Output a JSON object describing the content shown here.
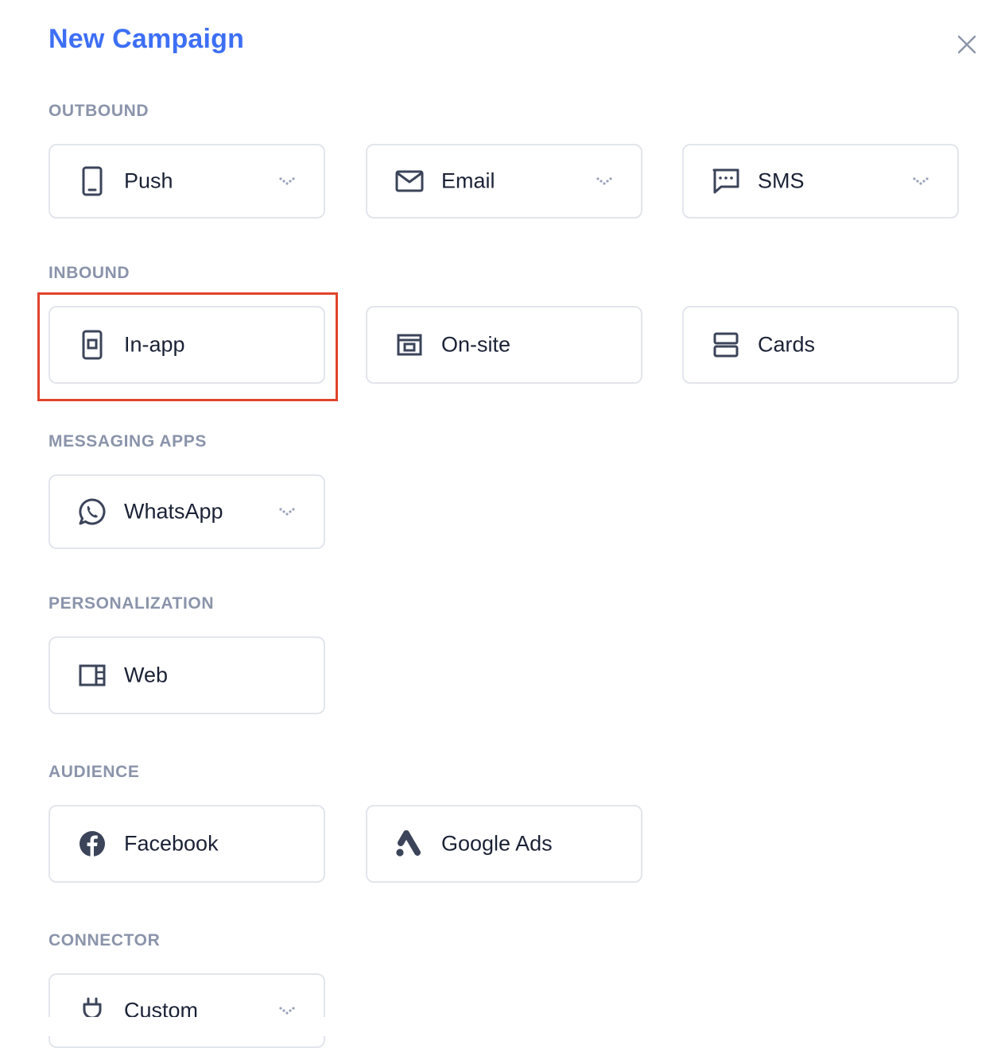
{
  "header": {
    "title": "New Campaign"
  },
  "sections": {
    "outbound": {
      "heading": "OUTBOUND",
      "push": {
        "label": "Push",
        "icon": "mobile-phone-icon"
      },
      "email": {
        "label": "Email",
        "icon": "envelope-icon"
      },
      "sms": {
        "label": "SMS",
        "icon": "chat-bubble-icon"
      }
    },
    "inbound": {
      "heading": "INBOUND",
      "inapp": {
        "label": "In-app",
        "icon": "in-app-message-icon"
      },
      "onsite": {
        "label": "On-site",
        "icon": "on-site-icon"
      },
      "cards": {
        "label": "Cards",
        "icon": "cards-icon"
      }
    },
    "messaging_apps": {
      "heading": "MESSAGING APPS",
      "whatsapp": {
        "label": "WhatsApp",
        "icon": "whatsapp-icon"
      }
    },
    "personalization": {
      "heading": "PERSONALIZATION",
      "web": {
        "label": "Web",
        "icon": "web-layout-icon"
      }
    },
    "audience": {
      "heading": "AUDIENCE",
      "facebook": {
        "label": "Facebook",
        "icon": "facebook-icon"
      },
      "google_ads": {
        "label": "Google Ads",
        "icon": "google-ads-icon"
      }
    },
    "connector": {
      "heading": "CONNECTOR",
      "custom": {
        "label": "Custom",
        "icon": "plug-icon"
      }
    }
  },
  "colors": {
    "title": "#3d6ff5",
    "section_heading": "#8a94aa",
    "tile_border": "#e2e5ec",
    "icon": "#3b4459",
    "highlight": "#e0432b"
  }
}
